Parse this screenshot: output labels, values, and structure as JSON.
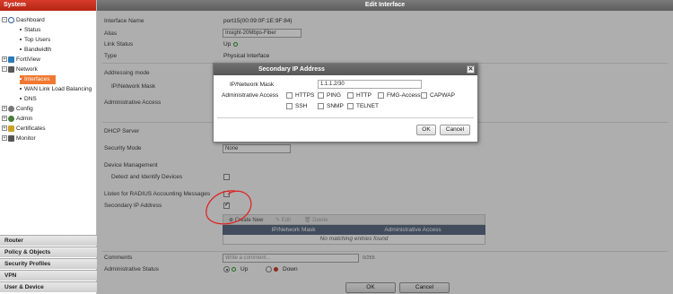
{
  "sidebar": {
    "header": "System",
    "tree": [
      {
        "label": "Dashboard",
        "expander": "−",
        "icon": "dashboard-icon"
      },
      {
        "label": "Status"
      },
      {
        "label": "Top Users"
      },
      {
        "label": "Bandwidth"
      },
      {
        "label": "FortiView",
        "expander": "+",
        "icon": "fortiview-icon"
      },
      {
        "label": "Network",
        "expander": "−",
        "icon": "network-icon"
      },
      {
        "label": "Interfaces",
        "selected": true
      },
      {
        "label": "WAN Link Load Balancing"
      },
      {
        "label": "DNS"
      },
      {
        "label": "Config",
        "expander": "+",
        "icon": "config-icon"
      },
      {
        "label": "Admin",
        "expander": "+",
        "icon": "admin-icon"
      },
      {
        "label": "Certificates",
        "expander": "+",
        "icon": "certificates-icon"
      },
      {
        "label": "Monitor",
        "expander": "+",
        "icon": "monitor-icon"
      }
    ],
    "nav": [
      "Router",
      "Policy & Objects",
      "Security Profiles",
      "VPN",
      "User & Device"
    ]
  },
  "main": {
    "title": "Edit Interface",
    "interface_name_label": "Interface Name",
    "interface_name_value": "port15(00:09:0F:1E:9F:84)",
    "alias_label": "Alias",
    "alias_value": "Insight-20Mbps-Fiber",
    "link_status_label": "Link Status",
    "link_status_value": "Up",
    "type_label": "Type",
    "type_value": "Physical Interface",
    "addressing_mode_label": "Addressing mode",
    "ip_mask_label": "IP/Network Mask",
    "admin_access_label": "Administrative Access",
    "dhcp_server_label": "DHCP Server",
    "security_mode_label": "Security Mode",
    "security_mode_value": "None",
    "device_mgmt_label": "Device Management",
    "detect_devices_label": "Detect and Identify Devices",
    "radius_label": "Listen for RADIUS Accounting Messages",
    "secondary_ip_label": "Secondary IP Address",
    "table": {
      "create_new": "Create New",
      "edit": "Edit",
      "delete": "Delete",
      "col_ip": "IP/Network Mask",
      "col_access": "Administrative Access",
      "empty": "No matching entries found"
    },
    "comments_label": "Comments",
    "comments_placeholder": "Write a comment...",
    "comments_counter": "0/255",
    "admin_status_label": "Administrative Status",
    "status_up": "Up",
    "status_down": "Down",
    "ok": "OK",
    "cancel": "Cancel"
  },
  "dialog": {
    "title": "Secondary IP Address",
    "ip_label": "IP/Network Mask",
    "ip_value": "1.1.1.2/30",
    "access_label": "Administrative Access",
    "access_options": [
      "HTTPS",
      "PING",
      "HTTP",
      "FMG-Access",
      "CAPWAP",
      "SSH",
      "SNMP",
      "TELNET"
    ],
    "ok": "OK",
    "cancel": "Cancel"
  },
  "colors": {
    "sidebar_header": "#c8301e",
    "selected_item": "#f07830",
    "table_header": "#5d6f86",
    "annotation": "#e02020"
  }
}
